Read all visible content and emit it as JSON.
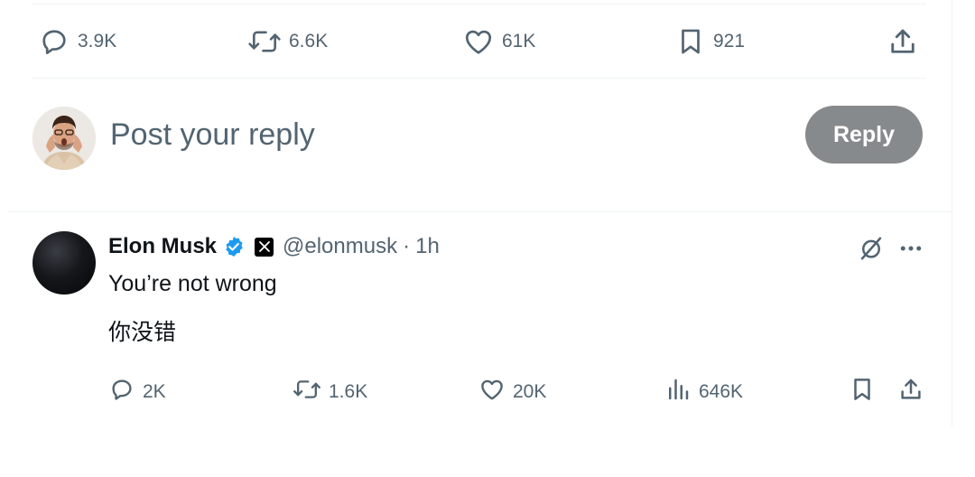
{
  "top_actions": {
    "replies": "3.9K",
    "reposts": "6.6K",
    "likes": "61K",
    "bookmarks": "921"
  },
  "composer": {
    "placeholder": "Post your reply",
    "reply_label": "Reply"
  },
  "reply_tweet": {
    "name": "Elon Musk",
    "handle": "@elonmusk",
    "separator": "·",
    "time": "1h",
    "text_en": "You’re not wrong",
    "text_zh": "你没错",
    "replies": "2K",
    "reposts": "1.6K",
    "likes": "20K",
    "views": "646K"
  },
  "colors": {
    "secondary_text": "#536471",
    "verified_blue": "#1d9bf0",
    "reply_button_disabled": "#878a8c",
    "divider": "#eff3f4"
  },
  "icons": [
    "reply-icon",
    "repost-icon",
    "like-icon",
    "bookmark-icon",
    "share-icon",
    "verified-icon",
    "x-affiliate-icon",
    "grok-icon",
    "more-icon",
    "views-icon"
  ]
}
